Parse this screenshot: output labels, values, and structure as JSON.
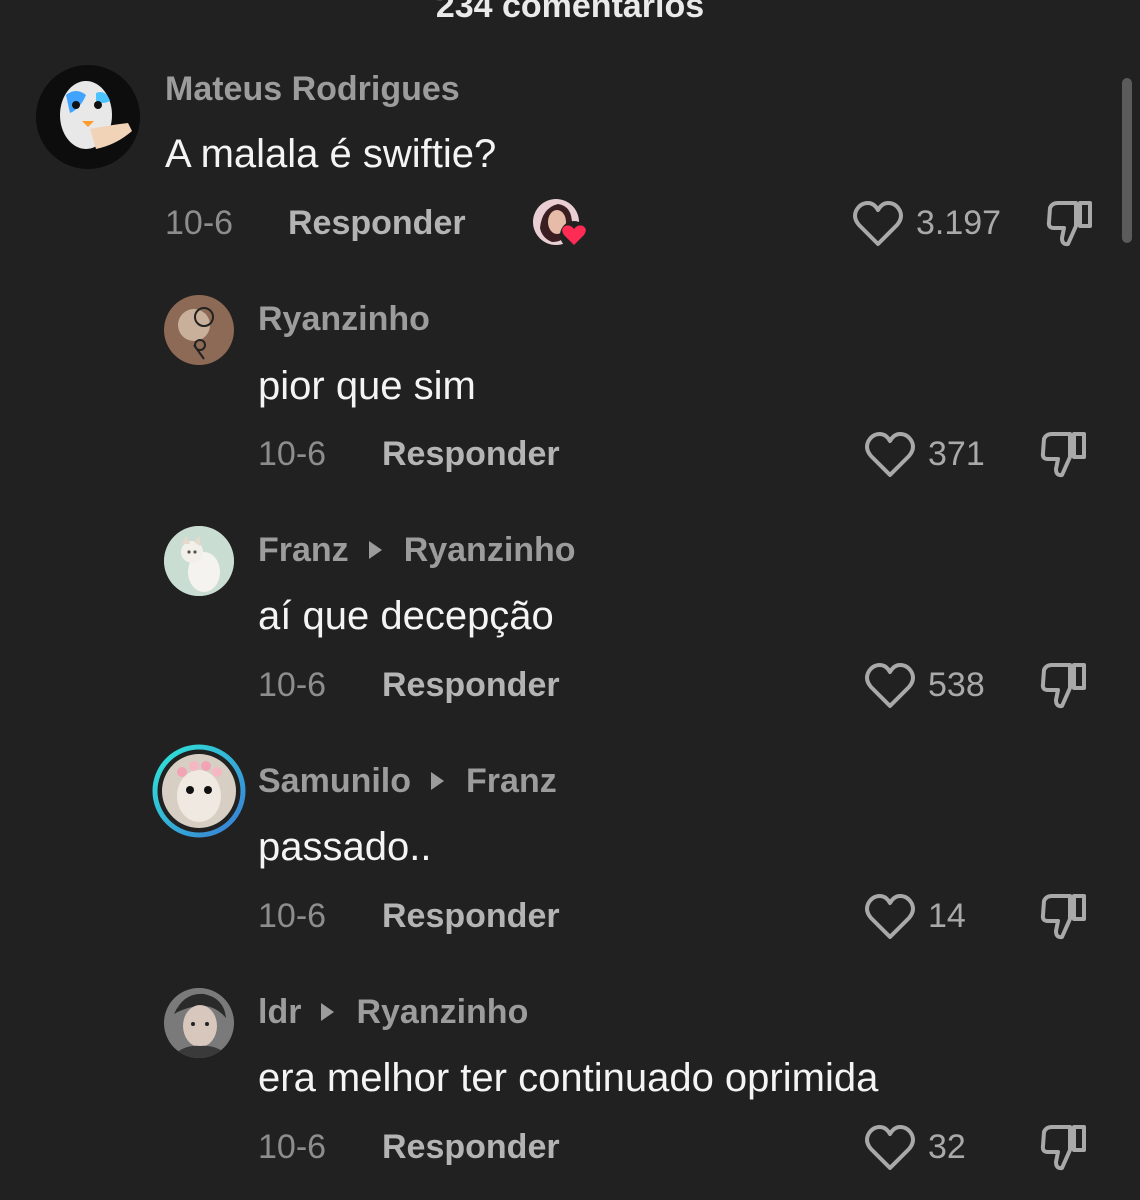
{
  "header": {
    "title": "234 comentários"
  },
  "comments": [
    {
      "username": "Mateus Rodrigues",
      "reply_to": "",
      "text": "A malala é swiftie?",
      "date": "10-6",
      "reply_label": "Responder",
      "likes": "3.197",
      "creator_liked": true
    },
    {
      "username": "Ryanzinho",
      "reply_to": "",
      "text": "pior que sim",
      "date": "10-6",
      "reply_label": "Responder",
      "likes": "371"
    },
    {
      "username": "Franz",
      "reply_to": "Ryanzinho",
      "text": "aí que decepção",
      "date": "10-6",
      "reply_label": "Responder",
      "likes": "538"
    },
    {
      "username": "Samunilo",
      "reply_to": "Franz",
      "text": "passado..",
      "date": "10-6",
      "reply_label": "Responder",
      "likes": "14"
    },
    {
      "username": "ldr",
      "reply_to": "Ryanzinho",
      "text": "era melhor ter continuado oprimida",
      "date": "10-6",
      "reply_label": "Responder",
      "likes": "32"
    }
  ],
  "colors": {
    "background": "#212121",
    "story_ring_start": "#2ee8d8",
    "story_ring_end": "#3a7bd5",
    "heart_badge": "#fe2c55"
  },
  "icons": {
    "like": "heart-outline-icon",
    "dislike": "thumbs-down-icon",
    "reply_arrow": "triangle-right-icon"
  }
}
